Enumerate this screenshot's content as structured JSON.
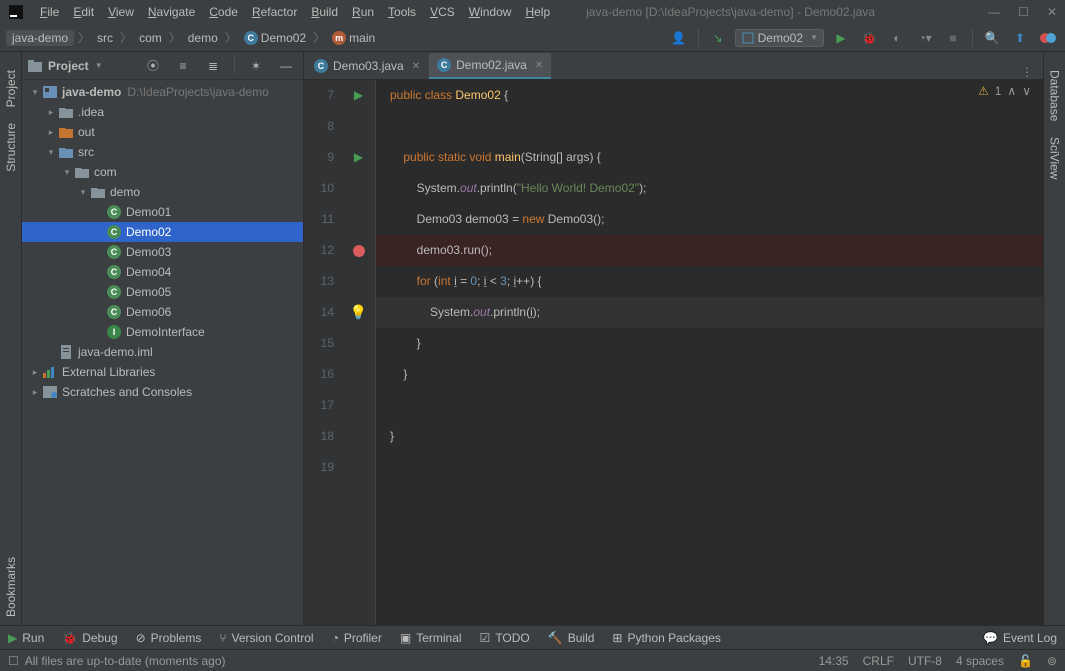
{
  "title": "java-demo [D:\\IdeaProjects\\java-demo] - Demo02.java",
  "menu": [
    "File",
    "Edit",
    "View",
    "Navigate",
    "Code",
    "Refactor",
    "Build",
    "Run",
    "Tools",
    "VCS",
    "Window",
    "Help"
  ],
  "breadcrumb": [
    {
      "label": "java-demo",
      "icon": "folder"
    },
    {
      "label": "src",
      "icon": null
    },
    {
      "label": "com",
      "icon": null
    },
    {
      "label": "demo",
      "icon": null
    },
    {
      "label": "Demo02",
      "icon": "class"
    },
    {
      "label": "main",
      "icon": "method"
    }
  ],
  "run_config": "Demo02",
  "left_tabs": [
    "Project",
    "Structure",
    "Bookmarks"
  ],
  "right_tabs": [
    "Database",
    "SciView"
  ],
  "project_pane": {
    "title": "Project",
    "root": {
      "label": "java-demo",
      "path": "D:\\IdeaProjects\\java-demo"
    },
    "idea": ".idea",
    "out": "out",
    "src": "src",
    "com": "com",
    "demo": "demo",
    "files": [
      "Demo01",
      "Demo02",
      "Demo03",
      "Demo04",
      "Demo05",
      "Demo06",
      "DemoInterface"
    ],
    "iml": "java-demo.iml",
    "ext_lib": "External Libraries",
    "scratches": "Scratches and Consoles"
  },
  "tabs": [
    {
      "label": "Demo03.java",
      "active": false
    },
    {
      "label": "Demo02.java",
      "active": true
    }
  ],
  "editor_status": {
    "warnings": "1"
  },
  "code_lines": [
    {
      "n": 7,
      "gutter": "run",
      "html": "<span class='kw'>public</span> <span class='kw'>class</span> <span class='decl'>Demo02</span> {"
    },
    {
      "n": 8,
      "gutter": "",
      "html": ""
    },
    {
      "n": 9,
      "gutter": "run",
      "fold": "-",
      "html": "    <span class='kw'>public</span> <span class='kw'>static</span> <span class='kw'>void</span> <span class='decl'>main</span>(String[] args) {"
    },
    {
      "n": 10,
      "gutter": "",
      "html": "        System.<span class='fld'>out</span>.println(<span class='str'>\"Hello World! Demo02\"</span>);"
    },
    {
      "n": 11,
      "gutter": "",
      "html": "        Demo03 demo03 = <span class='kw'>new</span> Demo03();"
    },
    {
      "n": 12,
      "gutter": "bp",
      "cls": "bp-line",
      "html": "        demo03.run();"
    },
    {
      "n": 13,
      "gutter": "",
      "fold": "-",
      "html": "        <span class='kw'>for</span> (<span class='kw'>int</span> <span class='und'>i</span> = <span class='num'>0</span>; <span class='und'>i</span> &lt; <span class='num'>3</span>; <span class='und'>i</span>++) {"
    },
    {
      "n": 14,
      "gutter": "bulb",
      "cls": "cur",
      "html": "            System.<span class='fld'>out</span>.println(<span class='und'>i</span>);"
    },
    {
      "n": 15,
      "gutter": "",
      "fold": "-",
      "html": "        }"
    },
    {
      "n": 16,
      "gutter": "",
      "fold": "-",
      "html": "    }"
    },
    {
      "n": 17,
      "gutter": "",
      "html": ""
    },
    {
      "n": 18,
      "gutter": "",
      "html": "}"
    },
    {
      "n": 19,
      "gutter": "",
      "html": ""
    }
  ],
  "bottom_tools": [
    "Run",
    "Debug",
    "Problems",
    "Version Control",
    "Profiler",
    "Terminal",
    "TODO",
    "Build",
    "Python Packages"
  ],
  "event_log": "Event Log",
  "status": {
    "msg": "All files are up-to-date (moments ago)",
    "pos": "14:35",
    "lineend": "CRLF",
    "enc": "UTF-8",
    "indent": "4 spaces"
  }
}
